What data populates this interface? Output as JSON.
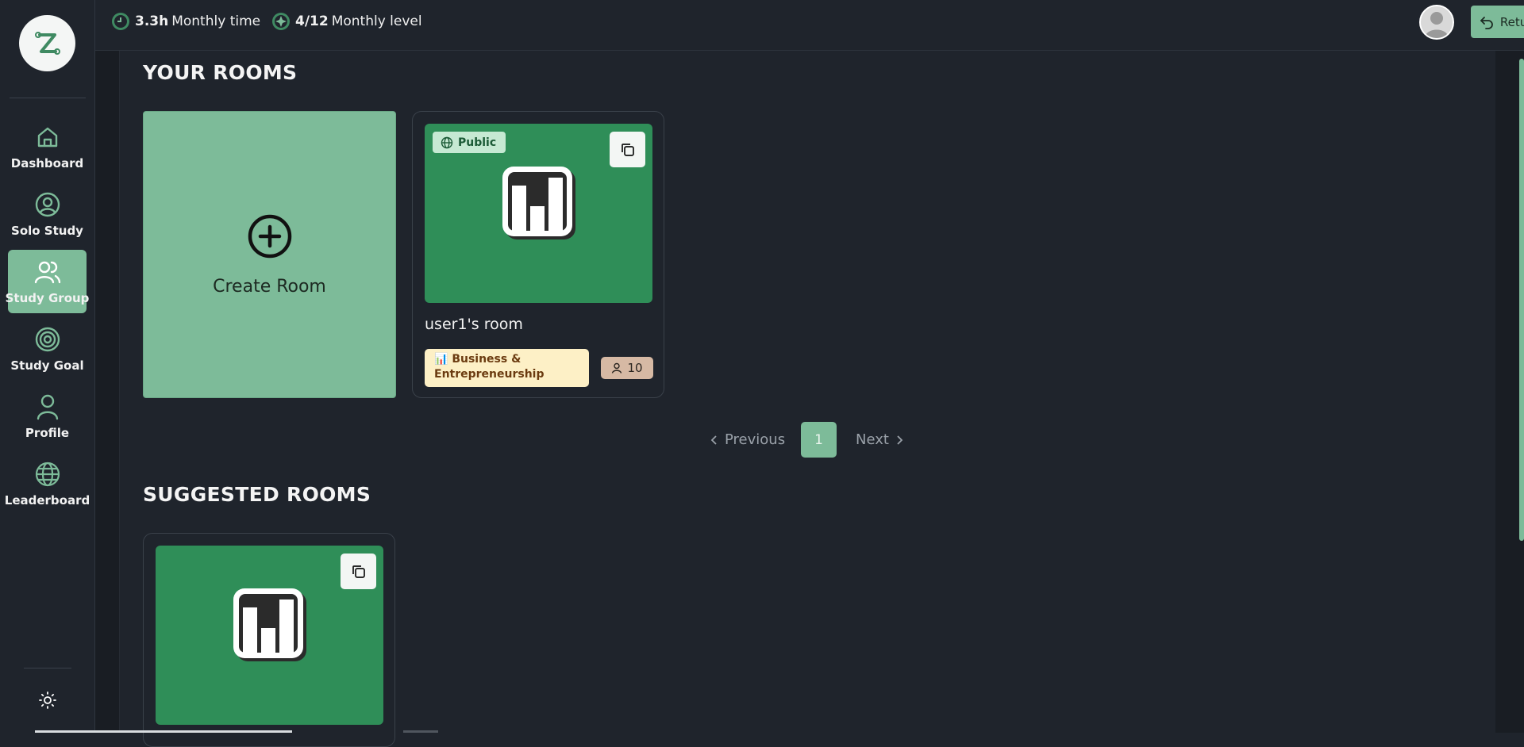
{
  "sidebar": {
    "logo_icon": "z-logo-icon",
    "items": [
      {
        "label": "Dashboard",
        "icon": "home-icon",
        "active": false
      },
      {
        "label": "Solo Study",
        "icon": "user-circle-icon",
        "active": false
      },
      {
        "label": "Study Group",
        "icon": "users-icon",
        "active": true
      },
      {
        "label": "Study Goal",
        "icon": "target-icon",
        "active": false
      },
      {
        "label": "Profile",
        "icon": "user-icon",
        "active": false
      },
      {
        "label": "Leaderboard",
        "icon": "globe-icon",
        "active": false
      }
    ],
    "theme_icon": "sun-icon"
  },
  "topbar": {
    "monthly_time_value": "3.3h",
    "monthly_time_label": "Monthly time",
    "monthly_level_value": "4/12",
    "monthly_level_label": "Monthly level",
    "return_button": "Return to room"
  },
  "your_rooms": {
    "title": "YOUR ROOMS",
    "create_label": "Create Room",
    "rooms": [
      {
        "visibility": "Public",
        "name": "user1's room",
        "category_emoji": "📊",
        "category": "Business & Entrepreneurship",
        "members": "10"
      }
    ]
  },
  "pagination": {
    "previous": "Previous",
    "current": "1",
    "next": "Next"
  },
  "suggested_rooms": {
    "title": "SUGGESTED ROOMS"
  },
  "colors": {
    "accent": "#7dbb99",
    "background": "#1f242c",
    "thumb": "#2f8e58"
  }
}
